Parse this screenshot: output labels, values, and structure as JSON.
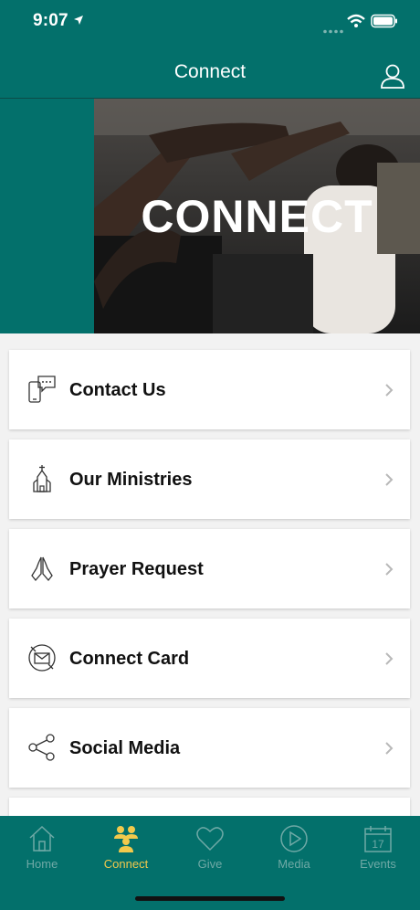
{
  "status_bar": {
    "time": "9:07"
  },
  "nav": {
    "title": "Connect"
  },
  "hero": {
    "text": "CONNECT"
  },
  "items": [
    {
      "label": "Contact Us",
      "icon": "phone-chat-icon"
    },
    {
      "label": "Our Ministries",
      "icon": "church-icon"
    },
    {
      "label": "Prayer Request",
      "icon": "praying-hands-icon"
    },
    {
      "label": "Connect Card",
      "icon": "envelope-icon"
    },
    {
      "label": "Social Media",
      "icon": "share-icon"
    }
  ],
  "tabs": [
    {
      "label": "Home",
      "icon": "home-icon"
    },
    {
      "label": "Connect",
      "icon": "people-icon",
      "active": true
    },
    {
      "label": "Give",
      "icon": "heart-icon"
    },
    {
      "label": "Media",
      "icon": "play-icon"
    },
    {
      "label": "Events",
      "icon": "calendar-icon",
      "calendar_day": "17"
    }
  ],
  "colors": {
    "brand": "#03706b",
    "active_tab": "#f2c94c",
    "inactive_tab": "#6fa9a6"
  }
}
